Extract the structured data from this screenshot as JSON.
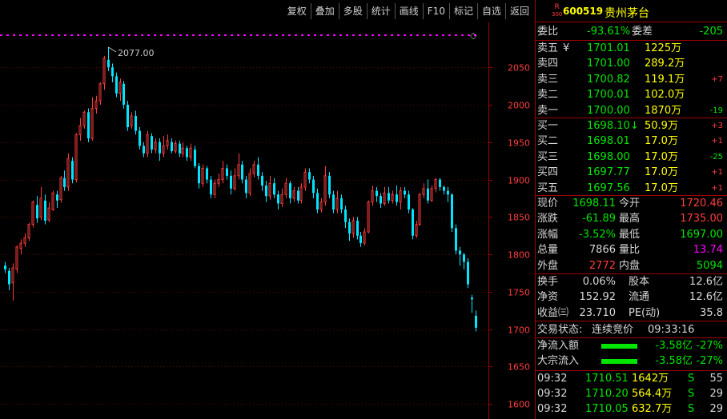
{
  "toolbar": {
    "buttons": [
      "复权",
      "叠加",
      "多股",
      "统计",
      "画线",
      "F10",
      "标记",
      "自选",
      "返回"
    ]
  },
  "stock": {
    "badge_top": "R",
    "badge_bottom": "300",
    "code": "600519",
    "name": "贵州茅台"
  },
  "committee": {
    "ratio_label": "委比",
    "ratio_value": "-93.61%",
    "diff_label": "委差",
    "diff_value": "-205"
  },
  "asks": [
    {
      "label": "卖五",
      "marker": "¥",
      "price": "1701.01",
      "volume": "1225万",
      "change": ""
    },
    {
      "label": "卖四",
      "marker": "",
      "price": "1701.00",
      "volume": "289.2万",
      "change": ""
    },
    {
      "label": "卖三",
      "marker": "",
      "price": "1700.82",
      "volume": "119.1万",
      "change": "+7"
    },
    {
      "label": "卖二",
      "marker": "",
      "price": "1700.01",
      "volume": "102.0万",
      "change": ""
    },
    {
      "label": "卖一",
      "marker": "",
      "price": "1700.00",
      "volume": "1870万",
      "change": "-19"
    }
  ],
  "bids": [
    {
      "label": "买一",
      "marker": "↓",
      "price": "1698.10",
      "volume": "50.9万",
      "change": "+3"
    },
    {
      "label": "买二",
      "marker": "",
      "price": "1698.01",
      "volume": "17.0万",
      "change": "+1"
    },
    {
      "label": "买三",
      "marker": "",
      "price": "1698.00",
      "volume": "17.0万",
      "change": "-25"
    },
    {
      "label": "买四",
      "marker": "",
      "price": "1697.77",
      "volume": "17.0万",
      "change": "+1"
    },
    {
      "label": "买五",
      "marker": "",
      "price": "1697.56",
      "volume": "17.0万",
      "change": "+1"
    }
  ],
  "quote": {
    "rows": [
      {
        "l1": "现价",
        "v1": "1698.11",
        "c1": "g",
        "l2": "今开",
        "v2": "1720.46",
        "c2": "r"
      },
      {
        "l1": "涨跌",
        "v1": "-61.89",
        "c1": "g",
        "l2": "最高",
        "v2": "1735.00",
        "c2": "r"
      },
      {
        "l1": "涨幅",
        "v1": "-3.52%",
        "c1": "g",
        "l2": "最低",
        "v2": "1697.00",
        "c2": "g"
      },
      {
        "l1": "总量",
        "v1": "7866",
        "c1": "w",
        "l2": "量比",
        "v2": "13.74",
        "c2": "m"
      },
      {
        "l1": "外盘",
        "v1": "2772",
        "c1": "r",
        "l2": "内盘",
        "v2": "5094",
        "c2": "g"
      }
    ]
  },
  "fundamentals": {
    "rows": [
      {
        "l1": "换手",
        "v1": "0.06%",
        "l2": "股本",
        "v2": "12.6亿"
      },
      {
        "l1": "净资",
        "v1": "152.92",
        "l2": "流通",
        "v2": "12.6亿"
      },
      {
        "l1": "收益㈢",
        "v1": "23.710",
        "l2": "PE(动)",
        "v2": "35.8"
      }
    ]
  },
  "trading_status": {
    "label": "交易状态:",
    "value": "连续竞价",
    "time": "09:33:16"
  },
  "flows": [
    {
      "label": "净流入额",
      "amount": "-3.58亿",
      "pct": "-27%",
      "bar_fraction": 0.27
    },
    {
      "label": "大宗流入",
      "amount": "-3.58亿",
      "pct": "-27%",
      "bar_fraction": 0.27
    }
  ],
  "ticks": [
    {
      "time": "09:32",
      "price": "1710.51",
      "volume": "1642万",
      "side": "S",
      "count": "55"
    },
    {
      "time": "09:32",
      "price": "1710.20",
      "volume": "564.4万",
      "side": "S",
      "count": "29"
    },
    {
      "time": "09:32",
      "price": "1710.05",
      "volume": "632.7万",
      "side": "S",
      "count": "29"
    }
  ],
  "chart_data": {
    "type": "candlestick",
    "y_ticks": [
      2050,
      2000,
      1950,
      1900,
      1850,
      1800,
      1750,
      1700,
      1650,
      1600
    ],
    "ylim": [
      1580,
      2110
    ],
    "annotation": "2077.00",
    "annotation_value": 2077.0,
    "grid": true,
    "colors": {
      "up": "#ff3c3c",
      "down": "#00e5ff",
      "grid": "#5a0000",
      "reference_line": "#ff00ff"
    },
    "candles": [
      [
        1785,
        1780,
        1790,
        1775
      ],
      [
        1778,
        1760,
        1782,
        1752
      ],
      [
        1762,
        1782,
        1788,
        1738
      ],
      [
        1780,
        1810,
        1812,
        1775
      ],
      [
        1808,
        1815,
        1820,
        1800
      ],
      [
        1815,
        1822,
        1828,
        1810
      ],
      [
        1822,
        1840,
        1842,
        1818
      ],
      [
        1840,
        1870,
        1872,
        1836
      ],
      [
        1866,
        1848,
        1878,
        1842
      ],
      [
        1850,
        1875,
        1890,
        1846
      ],
      [
        1872,
        1845,
        1880,
        1840
      ],
      [
        1846,
        1862,
        1870,
        1843
      ],
      [
        1860,
        1882,
        1885,
        1858
      ],
      [
        1880,
        1872,
        1885,
        1862
      ],
      [
        1873,
        1902,
        1905,
        1869
      ],
      [
        1902,
        1890,
        1912,
        1885
      ],
      [
        1890,
        1928,
        1935,
        1885
      ],
      [
        1925,
        1900,
        1930,
        1895
      ],
      [
        1900,
        1960,
        1962,
        1896
      ],
      [
        1960,
        1972,
        1982,
        1952
      ],
      [
        1972,
        1990,
        1992,
        1968
      ],
      [
        1990,
        1955,
        1995,
        1950
      ],
      [
        1955,
        1995,
        2010,
        1952
      ],
      [
        1995,
        2005,
        2012,
        1988
      ],
      [
        2005,
        2028,
        2030,
        2000
      ],
      [
        2028,
        2062,
        2065,
        2020
      ],
      [
        2060,
        2050,
        2077,
        2045
      ],
      [
        2050,
        2038,
        2055,
        2030
      ],
      [
        2038,
        2015,
        2043,
        2010
      ],
      [
        2015,
        2030,
        2035,
        2005
      ],
      [
        2028,
        2000,
        2032,
        1995
      ],
      [
        2000,
        1970,
        2005,
        1965
      ],
      [
        1972,
        1985,
        1990,
        1968
      ],
      [
        1985,
        1965,
        1992,
        1960
      ],
      [
        1965,
        1945,
        1970,
        1940
      ],
      [
        1945,
        1935,
        1950,
        1930
      ],
      [
        1935,
        1960,
        1965,
        1930
      ],
      [
        1958,
        1940,
        1962,
        1935
      ],
      [
        1940,
        1950,
        1955,
        1935
      ],
      [
        1950,
        1935,
        1955,
        1925
      ],
      [
        1935,
        1945,
        1958,
        1930
      ],
      [
        1945,
        1952,
        1960,
        1940
      ],
      [
        1950,
        1938,
        1955,
        1935
      ],
      [
        1938,
        1948,
        1952,
        1935
      ],
      [
        1948,
        1935,
        1952,
        1930
      ],
      [
        1935,
        1942,
        1950,
        1930
      ],
      [
        1942,
        1930,
        1945,
        1925
      ],
      [
        1930,
        1942,
        1948,
        1925
      ],
      [
        1940,
        1918,
        1945,
        1915
      ],
      [
        1918,
        1895,
        1922,
        1888
      ],
      [
        1895,
        1915,
        1920,
        1890
      ],
      [
        1915,
        1900,
        1918,
        1895
      ],
      [
        1900,
        1880,
        1905,
        1875
      ],
      [
        1880,
        1895,
        1900,
        1875
      ],
      [
        1895,
        1900,
        1908,
        1890
      ],
      [
        1900,
        1915,
        1925,
        1895
      ],
      [
        1915,
        1905,
        1920,
        1900
      ],
      [
        1905,
        1888,
        1912,
        1880
      ],
      [
        1888,
        1905,
        1915,
        1885
      ],
      [
        1905,
        1920,
        1935,
        1900
      ],
      [
        1920,
        1900,
        1925,
        1895
      ],
      [
        1900,
        1882,
        1905,
        1875
      ],
      [
        1882,
        1908,
        1915,
        1878
      ],
      [
        1908,
        1920,
        1925,
        1903
      ],
      [
        1920,
        1905,
        1930,
        1900
      ],
      [
        1905,
        1892,
        1910,
        1885
      ],
      [
        1892,
        1878,
        1898,
        1870
      ],
      [
        1878,
        1895,
        1905,
        1873
      ],
      [
        1895,
        1880,
        1902,
        1875
      ],
      [
        1880,
        1868,
        1885,
        1860
      ],
      [
        1868,
        1880,
        1888,
        1863
      ],
      [
        1880,
        1895,
        1902,
        1875
      ],
      [
        1895,
        1875,
        1898,
        1868
      ],
      [
        1875,
        1885,
        1890,
        1870
      ],
      [
        1885,
        1872,
        1890,
        1868
      ],
      [
        1872,
        1890,
        1895,
        1868
      ],
      [
        1890,
        1910,
        1915,
        1885
      ],
      [
        1910,
        1900,
        1915,
        1895
      ],
      [
        1900,
        1882,
        1905,
        1875
      ],
      [
        1882,
        1860,
        1888,
        1855
      ],
      [
        1860,
        1870,
        1875,
        1856
      ],
      [
        1870,
        1905,
        1918,
        1865
      ],
      [
        1905,
        1880,
        1910,
        1875
      ],
      [
        1880,
        1860,
        1885,
        1855
      ],
      [
        1860,
        1875,
        1885,
        1855
      ],
      [
        1875,
        1860,
        1880,
        1855
      ],
      [
        1860,
        1843,
        1865,
        1835
      ],
      [
        1843,
        1828,
        1848,
        1818
      ],
      [
        1828,
        1845,
        1850,
        1822
      ],
      [
        1845,
        1825,
        1850,
        1820
      ],
      [
        1825,
        1815,
        1830,
        1810
      ],
      [
        1815,
        1830,
        1835,
        1812
      ],
      [
        1830,
        1870,
        1872,
        1828
      ],
      [
        1870,
        1885,
        1892,
        1865
      ],
      [
        1885,
        1878,
        1890,
        1870
      ],
      [
        1878,
        1868,
        1882,
        1862
      ],
      [
        1868,
        1882,
        1890,
        1865
      ],
      [
        1882,
        1872,
        1890,
        1868
      ],
      [
        1872,
        1880,
        1885,
        1868
      ],
      [
        1880,
        1870,
        1892,
        1865
      ],
      [
        1870,
        1885,
        1890,
        1860
      ],
      [
        1885,
        1880,
        1890,
        1875
      ],
      [
        1880,
        1860,
        1885,
        1855
      ],
      [
        1860,
        1825,
        1862,
        1820
      ],
      [
        1825,
        1840,
        1845,
        1822
      ],
      [
        1840,
        1880,
        1882,
        1838
      ],
      [
        1880,
        1888,
        1895,
        1875
      ],
      [
        1888,
        1872,
        1900,
        1868
      ],
      [
        1872,
        1888,
        1892,
        1870
      ],
      [
        1888,
        1900,
        1902,
        1883
      ],
      [
        1900,
        1890,
        1902,
        1885
      ],
      [
        1890,
        1885,
        1892,
        1880
      ],
      [
        1885,
        1880,
        1890,
        1870
      ],
      [
        1880,
        1835,
        1882,
        1830
      ],
      [
        1835,
        1805,
        1840,
        1800
      ],
      [
        1805,
        1800,
        1810,
        1785
      ],
      [
        1800,
        1790,
        1802,
        1780
      ],
      [
        1790,
        1760,
        1795,
        1755
      ],
      [
        1742,
        1740,
        1746,
        1722
      ],
      [
        1718,
        1702,
        1725,
        1697
      ]
    ]
  }
}
